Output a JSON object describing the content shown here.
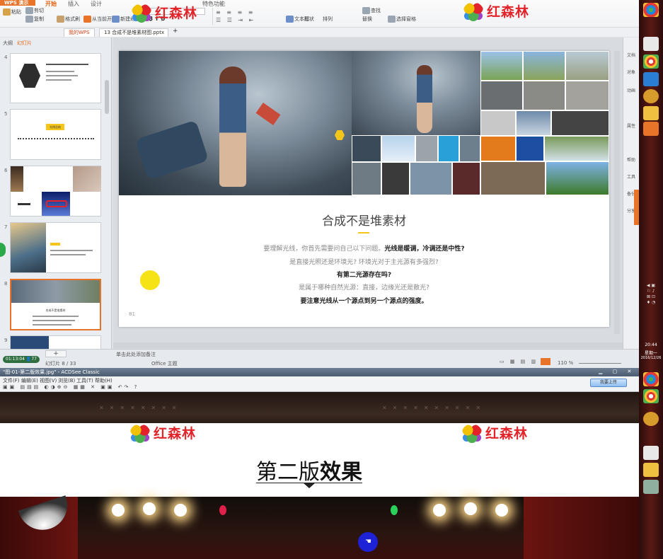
{
  "ppt": {
    "menu_label": "WPS 演示",
    "tabs": [
      "开始",
      "插入",
      "设计",
      "切换",
      "动画",
      "幻灯片放映",
      "审阅",
      "视图",
      "特色功能"
    ],
    "active_tab": "开始",
    "tools": [
      "粘贴",
      "剪切",
      "复制",
      "格式刷",
      "从当前开始",
      "新建幻灯片",
      "版式",
      "重置",
      "节",
      "文本框",
      "形状",
      "排列",
      "查找",
      "替换",
      "选择窗格"
    ],
    "doc_tabs": [
      "我的WPS",
      "13 合成不是堆素材图.pptx"
    ],
    "panel_tabs": [
      "大纲",
      "幻灯片"
    ],
    "status_left": "幻灯片 8 / 33",
    "status_theme": "Office 主题",
    "status_notes": "单击此处添加备注",
    "zoom": "110 %",
    "clock": "01:13:04",
    "viewers": "77",
    "slide": {
      "title": "合成不是堆素材",
      "line1_a": "要理解光线，你首先需要问自己以下问题。",
      "line1_b": "光线是暖调，冷调还是中性?",
      "line2": "是直接光照还是环境光? 环境光对于主光源有多强烈?",
      "line3": "有第二光源存在吗?",
      "line4": "是属于哪种自然光源：直接，边缘光还是散光?",
      "line5": "要注意光线从一个源点到另一个源点的强度。",
      "page_num": "81"
    },
    "thumbs": [
      {
        "num": "4"
      },
      {
        "num": "5",
        "badge": "光线总结"
      },
      {
        "num": "6"
      },
      {
        "num": "7"
      },
      {
        "num": "8",
        "caption": "合成不是堆素材"
      },
      {
        "num": "9"
      }
    ],
    "right_side": [
      "文档",
      "对象",
      "动画",
      "属性",
      "帮助",
      "工具",
      "备份",
      "分享"
    ]
  },
  "logo_text": "红森林",
  "viewer": {
    "title": "\"图-01-第二版效果.jpg\" - ACDSee Classic",
    "menu": [
      "文件(F)",
      "编辑(E)",
      "视图(V)",
      "浏览(B)",
      "工具(T)",
      "帮助(H)"
    ],
    "upload": "我要上传",
    "heading_a": "第二版",
    "heading_b": "效果"
  },
  "taskbar": {
    "time": "20:44",
    "day": "星期一",
    "date": "2016/12/26"
  }
}
